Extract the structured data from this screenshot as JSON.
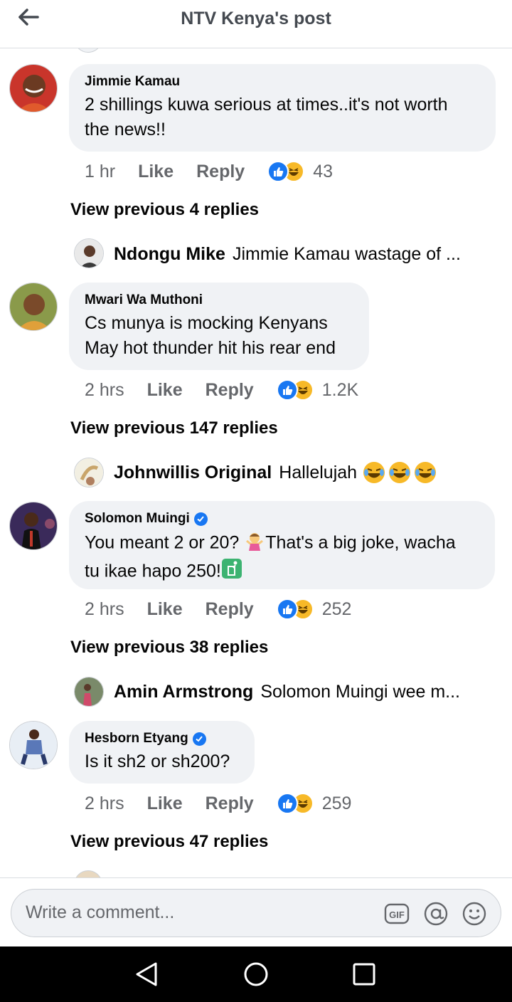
{
  "header": {
    "title": "NTV Kenya's post"
  },
  "comments": [
    {
      "author": "Jimmie Kamau",
      "verified": false,
      "text_lines": [
        "2 shillings kuwa serious at times..it's not worth",
        "the news!!"
      ],
      "time": "1 hr",
      "like_label": "Like",
      "reply_label": "Reply",
      "reaction_count": "43",
      "view_previous": "View previous 4 replies",
      "latest_reply": {
        "author": "Ndongu Mike",
        "text": "Jimmie Kamau wastage of ..."
      }
    },
    {
      "author": "Mwari Wa Muthoni",
      "verified": false,
      "text_lines": [
        "Cs munya is mocking Kenyans",
        "May hot thunder hit his rear end"
      ],
      "time": "2 hrs",
      "like_label": "Like",
      "reply_label": "Reply",
      "reaction_count": "1.2K",
      "view_previous": "View previous 147 replies",
      "latest_reply": {
        "author": "Johnwillis Original",
        "text": "Hallelujah"
      }
    },
    {
      "author": "Solomon Muingi",
      "verified": true,
      "text_lines": [
        "You meant 2 or 20? ",
        "That's a big joke, wacha",
        "tu ikae hapo 250!"
      ],
      "time": "2 hrs",
      "like_label": "Like",
      "reply_label": "Reply",
      "reaction_count": "252",
      "view_previous": "View previous 38 replies",
      "latest_reply": {
        "author": "Amin Armstrong",
        "text": "Solomon Muingi wee m..."
      }
    },
    {
      "author": "Hesborn Etyang",
      "verified": true,
      "text_lines": [
        "Is it sh2 or sh200?"
      ],
      "time": "2 hrs",
      "like_label": "Like",
      "reply_label": "Reply",
      "reaction_count": "259",
      "view_previous": "View previous 47 replies"
    }
  ],
  "composer": {
    "placeholder": "Write a comment...",
    "gif_label": "GIF"
  },
  "icons": {
    "back": "arrow-left-icon",
    "like_reaction": "like-reaction-icon",
    "haha_reaction": "haha-reaction-icon",
    "verified": "verified-badge-icon",
    "gif": "gif-icon",
    "mention": "at-sign-icon",
    "emoji": "emoji-smile-icon",
    "nav_back": "triangle-back-icon",
    "nav_home": "circle-home-icon",
    "nav_recents": "square-recents-icon"
  },
  "colors": {
    "accent": "#1877f2",
    "haha": "#f7b928",
    "bubble": "#f0f2f5",
    "muted": "#65676b"
  }
}
